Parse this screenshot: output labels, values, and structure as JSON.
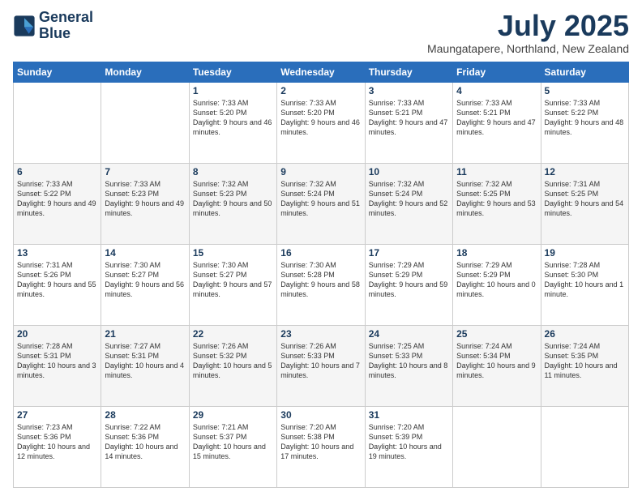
{
  "logo": {
    "line1": "General",
    "line2": "Blue"
  },
  "title": "July 2025",
  "subtitle": "Maungatapere, Northland, New Zealand",
  "weekdays": [
    "Sunday",
    "Monday",
    "Tuesday",
    "Wednesday",
    "Thursday",
    "Friday",
    "Saturday"
  ],
  "weeks": [
    [
      {
        "day": "",
        "sunrise": "",
        "sunset": "",
        "daylight": ""
      },
      {
        "day": "",
        "sunrise": "",
        "sunset": "",
        "daylight": ""
      },
      {
        "day": "1",
        "sunrise": "Sunrise: 7:33 AM",
        "sunset": "Sunset: 5:20 PM",
        "daylight": "Daylight: 9 hours and 46 minutes."
      },
      {
        "day": "2",
        "sunrise": "Sunrise: 7:33 AM",
        "sunset": "Sunset: 5:20 PM",
        "daylight": "Daylight: 9 hours and 46 minutes."
      },
      {
        "day": "3",
        "sunrise": "Sunrise: 7:33 AM",
        "sunset": "Sunset: 5:21 PM",
        "daylight": "Daylight: 9 hours and 47 minutes."
      },
      {
        "day": "4",
        "sunrise": "Sunrise: 7:33 AM",
        "sunset": "Sunset: 5:21 PM",
        "daylight": "Daylight: 9 hours and 47 minutes."
      },
      {
        "day": "5",
        "sunrise": "Sunrise: 7:33 AM",
        "sunset": "Sunset: 5:22 PM",
        "daylight": "Daylight: 9 hours and 48 minutes."
      }
    ],
    [
      {
        "day": "6",
        "sunrise": "Sunrise: 7:33 AM",
        "sunset": "Sunset: 5:22 PM",
        "daylight": "Daylight: 9 hours and 49 minutes."
      },
      {
        "day": "7",
        "sunrise": "Sunrise: 7:33 AM",
        "sunset": "Sunset: 5:23 PM",
        "daylight": "Daylight: 9 hours and 49 minutes."
      },
      {
        "day": "8",
        "sunrise": "Sunrise: 7:32 AM",
        "sunset": "Sunset: 5:23 PM",
        "daylight": "Daylight: 9 hours and 50 minutes."
      },
      {
        "day": "9",
        "sunrise": "Sunrise: 7:32 AM",
        "sunset": "Sunset: 5:24 PM",
        "daylight": "Daylight: 9 hours and 51 minutes."
      },
      {
        "day": "10",
        "sunrise": "Sunrise: 7:32 AM",
        "sunset": "Sunset: 5:24 PM",
        "daylight": "Daylight: 9 hours and 52 minutes."
      },
      {
        "day": "11",
        "sunrise": "Sunrise: 7:32 AM",
        "sunset": "Sunset: 5:25 PM",
        "daylight": "Daylight: 9 hours and 53 minutes."
      },
      {
        "day": "12",
        "sunrise": "Sunrise: 7:31 AM",
        "sunset": "Sunset: 5:25 PM",
        "daylight": "Daylight: 9 hours and 54 minutes."
      }
    ],
    [
      {
        "day": "13",
        "sunrise": "Sunrise: 7:31 AM",
        "sunset": "Sunset: 5:26 PM",
        "daylight": "Daylight: 9 hours and 55 minutes."
      },
      {
        "day": "14",
        "sunrise": "Sunrise: 7:30 AM",
        "sunset": "Sunset: 5:27 PM",
        "daylight": "Daylight: 9 hours and 56 minutes."
      },
      {
        "day": "15",
        "sunrise": "Sunrise: 7:30 AM",
        "sunset": "Sunset: 5:27 PM",
        "daylight": "Daylight: 9 hours and 57 minutes."
      },
      {
        "day": "16",
        "sunrise": "Sunrise: 7:30 AM",
        "sunset": "Sunset: 5:28 PM",
        "daylight": "Daylight: 9 hours and 58 minutes."
      },
      {
        "day": "17",
        "sunrise": "Sunrise: 7:29 AM",
        "sunset": "Sunset: 5:29 PM",
        "daylight": "Daylight: 9 hours and 59 minutes."
      },
      {
        "day": "18",
        "sunrise": "Sunrise: 7:29 AM",
        "sunset": "Sunset: 5:29 PM",
        "daylight": "Daylight: 10 hours and 0 minutes."
      },
      {
        "day": "19",
        "sunrise": "Sunrise: 7:28 AM",
        "sunset": "Sunset: 5:30 PM",
        "daylight": "Daylight: 10 hours and 1 minute."
      }
    ],
    [
      {
        "day": "20",
        "sunrise": "Sunrise: 7:28 AM",
        "sunset": "Sunset: 5:31 PM",
        "daylight": "Daylight: 10 hours and 3 minutes."
      },
      {
        "day": "21",
        "sunrise": "Sunrise: 7:27 AM",
        "sunset": "Sunset: 5:31 PM",
        "daylight": "Daylight: 10 hours and 4 minutes."
      },
      {
        "day": "22",
        "sunrise": "Sunrise: 7:26 AM",
        "sunset": "Sunset: 5:32 PM",
        "daylight": "Daylight: 10 hours and 5 minutes."
      },
      {
        "day": "23",
        "sunrise": "Sunrise: 7:26 AM",
        "sunset": "Sunset: 5:33 PM",
        "daylight": "Daylight: 10 hours and 7 minutes."
      },
      {
        "day": "24",
        "sunrise": "Sunrise: 7:25 AM",
        "sunset": "Sunset: 5:33 PM",
        "daylight": "Daylight: 10 hours and 8 minutes."
      },
      {
        "day": "25",
        "sunrise": "Sunrise: 7:24 AM",
        "sunset": "Sunset: 5:34 PM",
        "daylight": "Daylight: 10 hours and 9 minutes."
      },
      {
        "day": "26",
        "sunrise": "Sunrise: 7:24 AM",
        "sunset": "Sunset: 5:35 PM",
        "daylight": "Daylight: 10 hours and 11 minutes."
      }
    ],
    [
      {
        "day": "27",
        "sunrise": "Sunrise: 7:23 AM",
        "sunset": "Sunset: 5:36 PM",
        "daylight": "Daylight: 10 hours and 12 minutes."
      },
      {
        "day": "28",
        "sunrise": "Sunrise: 7:22 AM",
        "sunset": "Sunset: 5:36 PM",
        "daylight": "Daylight: 10 hours and 14 minutes."
      },
      {
        "day": "29",
        "sunrise": "Sunrise: 7:21 AM",
        "sunset": "Sunset: 5:37 PM",
        "daylight": "Daylight: 10 hours and 15 minutes."
      },
      {
        "day": "30",
        "sunrise": "Sunrise: 7:20 AM",
        "sunset": "Sunset: 5:38 PM",
        "daylight": "Daylight: 10 hours and 17 minutes."
      },
      {
        "day": "31",
        "sunrise": "Sunrise: 7:20 AM",
        "sunset": "Sunset: 5:39 PM",
        "daylight": "Daylight: 10 hours and 19 minutes."
      },
      {
        "day": "",
        "sunrise": "",
        "sunset": "",
        "daylight": ""
      },
      {
        "day": "",
        "sunrise": "",
        "sunset": "",
        "daylight": ""
      }
    ]
  ]
}
